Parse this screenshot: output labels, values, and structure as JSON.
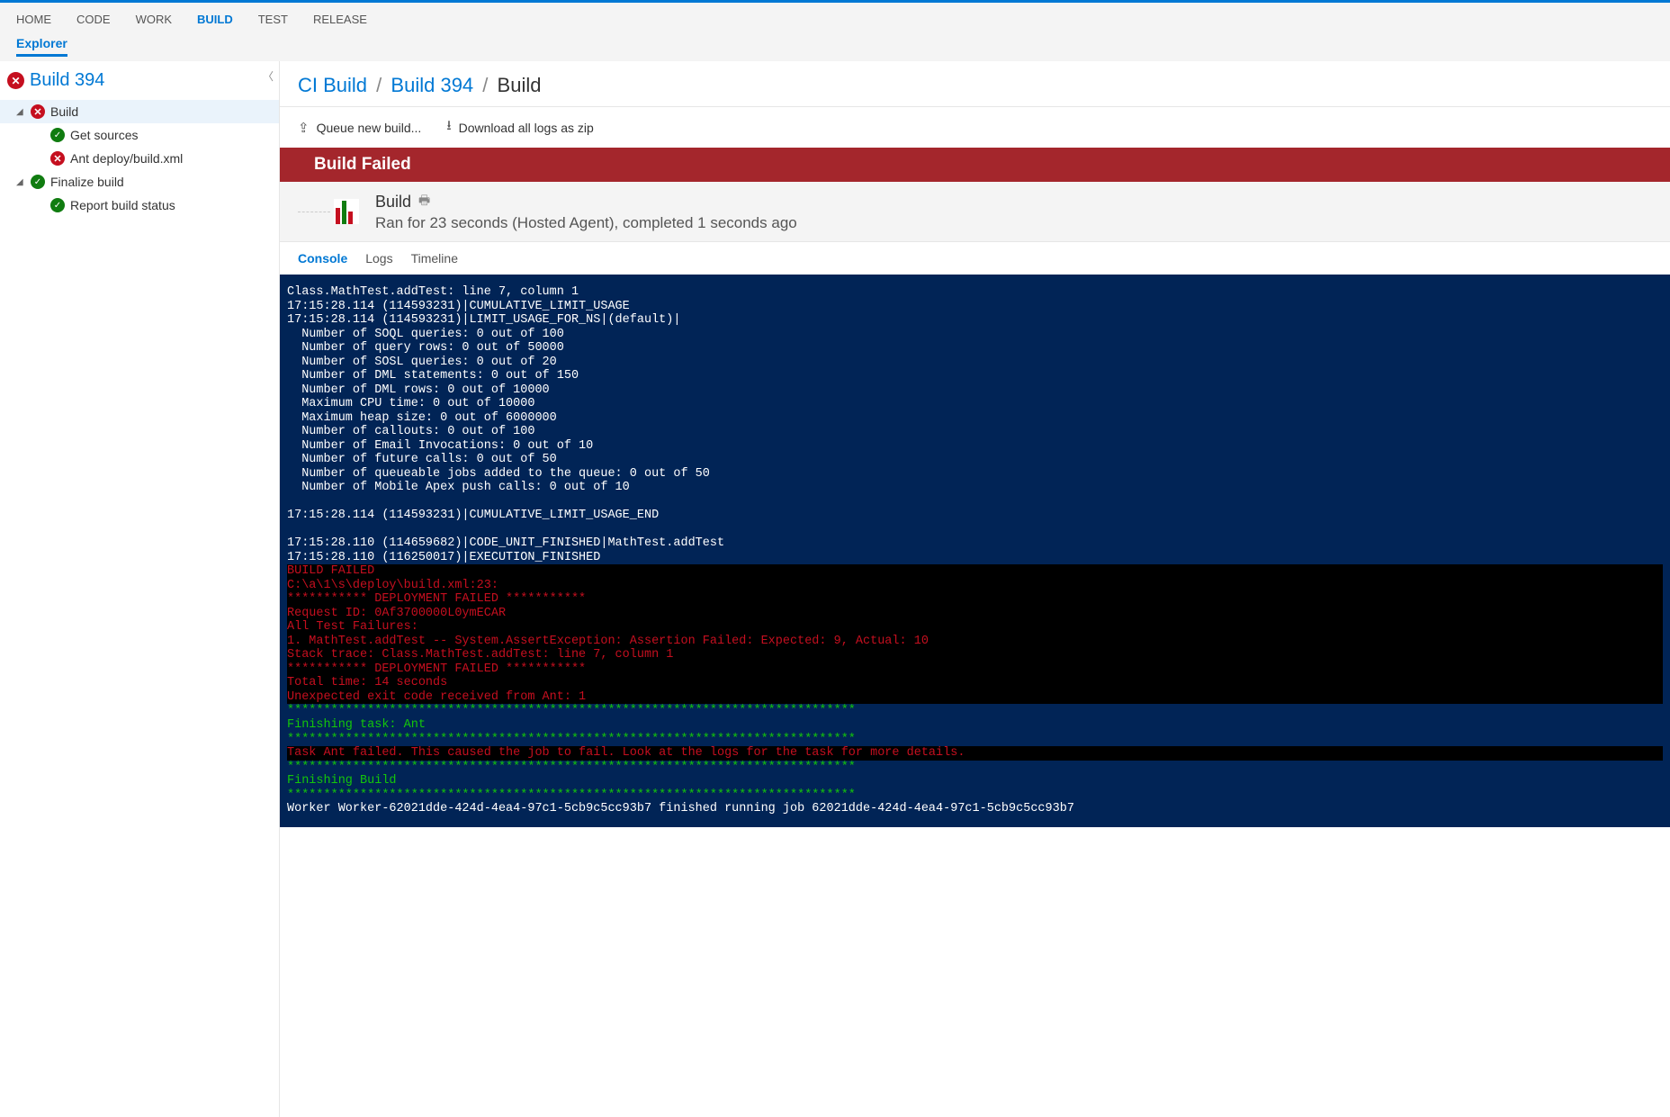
{
  "top_nav": {
    "items": [
      "HOME",
      "CODE",
      "WORK",
      "BUILD",
      "TEST",
      "RELEASE"
    ],
    "active_index": 3
  },
  "sub_nav": {
    "active": "Explorer"
  },
  "sidebar": {
    "title": "Build 394",
    "tree": {
      "build": {
        "label": "Build",
        "status": "error"
      },
      "get_sources": {
        "label": "Get sources",
        "status": "ok"
      },
      "ant_deploy": {
        "label": "Ant deploy/build.xml",
        "status": "error"
      },
      "finalize": {
        "label": "Finalize build",
        "status": "ok"
      },
      "report_status": {
        "label": "Report build status",
        "status": "ok"
      }
    }
  },
  "breadcrumb": {
    "ci_build": "CI Build",
    "build_394": "Build 394",
    "current": "Build"
  },
  "toolbar": {
    "queue": "Queue new build...",
    "download": "Download all logs as zip"
  },
  "status_banner": "Build Failed",
  "build_header": {
    "title": "Build",
    "subtitle": "Ran for 23 seconds (Hosted Agent), completed 1 seconds ago"
  },
  "result_tabs": {
    "items": [
      "Console",
      "Logs",
      "Timeline"
    ],
    "active_index": 0
  },
  "console": {
    "info": "Class.MathTest.addTest: line 7, column 1\n17:15:28.114 (114593231)|CUMULATIVE_LIMIT_USAGE\n17:15:28.114 (114593231)|LIMIT_USAGE_FOR_NS|(default)|\n  Number of SOQL queries: 0 out of 100\n  Number of query rows: 0 out of 50000\n  Number of SOSL queries: 0 out of 20\n  Number of DML statements: 0 out of 150\n  Number of DML rows: 0 out of 10000\n  Maximum CPU time: 0 out of 10000\n  Maximum heap size: 0 out of 6000000\n  Number of callouts: 0 out of 100\n  Number of Email Invocations: 0 out of 10\n  Number of future calls: 0 out of 50\n  Number of queueable jobs added to the queue: 0 out of 50\n  Number of Mobile Apex push calls: 0 out of 10\n\n17:15:28.114 (114593231)|CUMULATIVE_LIMIT_USAGE_END\n\n17:15:28.110 (114659682)|CODE_UNIT_FINISHED|MathTest.addTest\n17:15:28.110 (116250017)|EXECUTION_FINISHED\n",
    "error1": "BUILD FAILED\nC:\\a\\1\\s\\deploy\\build.xml:23:\n*********** DEPLOYMENT FAILED ***********\nRequest ID: 0Af3700000L0ymECAR\nAll Test Failures:\n1. MathTest.addTest -- System.AssertException: Assertion Failed: Expected: 9, Actual: 10\nStack trace: Class.MathTest.addTest: line 7, column 1\n*********** DEPLOYMENT FAILED ***********\nTotal time: 14 seconds\nUnexpected exit code received from Ant: 1",
    "green1": "******************************************************************************\nFinishing task: Ant\n******************************************************************************",
    "error2": "Task Ant failed. This caused the job to fail. Look at the logs for the task for more details.",
    "green2": "******************************************************************************\nFinishing Build\n******************************************************************************",
    "worker": "Worker Worker-62021dde-424d-4ea4-97c1-5cb9c5cc93b7 finished running job 62021dde-424d-4ea4-97c1-5cb9c5cc93b7"
  }
}
